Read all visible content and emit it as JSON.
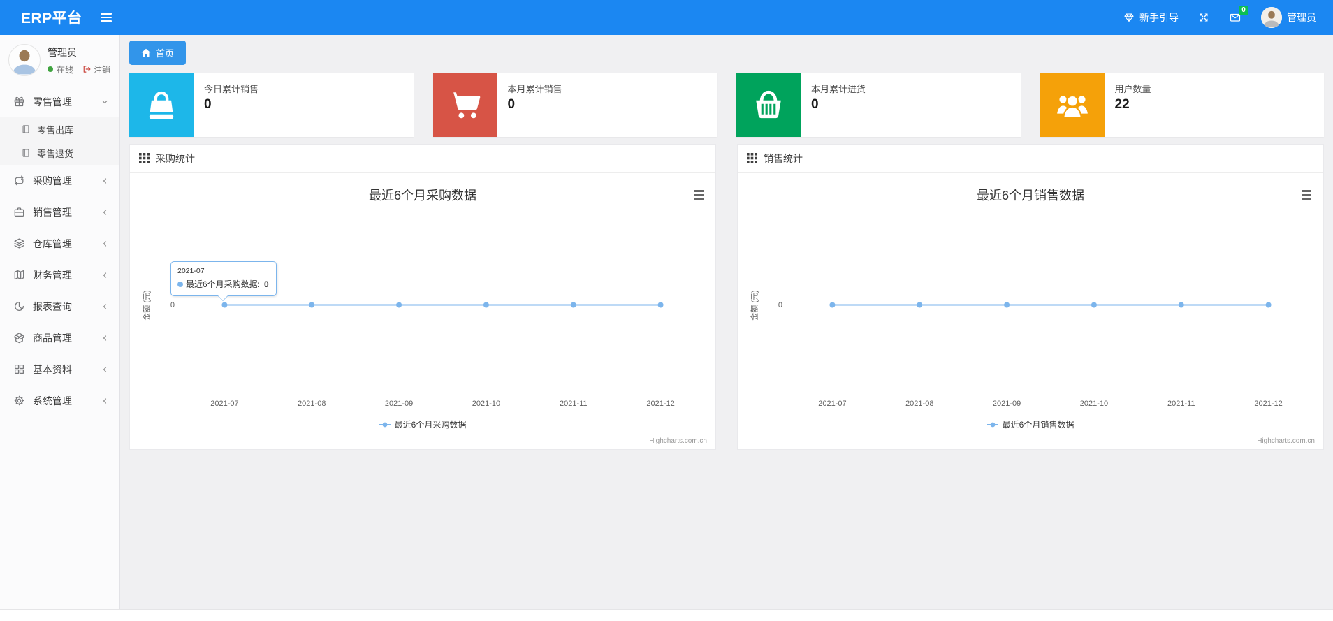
{
  "colors": {
    "navbar_bg": "#1b87f2",
    "tab_bg": "#3295ea",
    "badge_green": "#0cbf53",
    "status_green": "#3fa33f",
    "logout_red": "#c9443c",
    "series_blue": "#7cb5ec"
  },
  "navbar": {
    "brand": "ERP平台",
    "guide_label": "新手引导",
    "mail_badge": "0",
    "user_name": "管理员"
  },
  "sidebar": {
    "user": {
      "name": "管理员",
      "status": "在线",
      "logout": "注销"
    },
    "menu": [
      {
        "label": "零售管理",
        "icon": "gift-icon",
        "state": "expanded",
        "children": [
          "零售出库",
          "零售退货"
        ]
      },
      {
        "label": "采购管理",
        "icon": "repeat-icon",
        "state": "collapsed"
      },
      {
        "label": "销售管理",
        "icon": "briefcase-icon",
        "state": "collapsed"
      },
      {
        "label": "仓库管理",
        "icon": "layers-icon",
        "state": "collapsed"
      },
      {
        "label": "财务管理",
        "icon": "map-book-icon",
        "state": "collapsed"
      },
      {
        "label": "报表查询",
        "icon": "pie-chart-icon",
        "state": "collapsed"
      },
      {
        "label": "商品管理",
        "icon": "box-icon",
        "state": "collapsed"
      },
      {
        "label": "基本资料",
        "icon": "grid-4-icon",
        "state": "collapsed"
      },
      {
        "label": "系统管理",
        "icon": "gear-icon",
        "state": "collapsed"
      }
    ]
  },
  "tabs": {
    "home": "首页"
  },
  "stat_cards": [
    {
      "title": "今日累计销售",
      "value": "0",
      "color": "#1db7e9",
      "icon": "shopping-bag-icon"
    },
    {
      "title": "本月累计销售",
      "value": "0",
      "color": "#d75446",
      "icon": "shopping-cart-icon"
    },
    {
      "title": "本月累计进货",
      "value": "0",
      "color": "#00a35c",
      "icon": "shopping-basket-icon"
    },
    {
      "title": "用户数量",
      "value": "22",
      "color": "#f5a109",
      "icon": "users-icon"
    }
  ],
  "panels": [
    {
      "title": "采购统计"
    },
    {
      "title": "销售统计"
    }
  ],
  "chart_data": [
    {
      "type": "line",
      "title": "最近6个月采购数据",
      "categories": [
        "2021-07",
        "2021-08",
        "2021-09",
        "2021-10",
        "2021-11",
        "2021-12"
      ],
      "series": [
        {
          "name": "最近6个月采购数据",
          "values": [
            0,
            0,
            0,
            0,
            0,
            0
          ],
          "color": "#7cb5ec"
        }
      ],
      "ylabel": "金额 (元)",
      "ylim": [
        -1,
        1
      ],
      "yticks": [
        {
          "value": 0,
          "label": "0"
        }
      ],
      "legend_position": "bottom",
      "credit": "Highcharts.com.cn",
      "tooltip": {
        "header": "2021-07",
        "series_label": "最近6个月采购数据:",
        "value": "0"
      }
    },
    {
      "type": "line",
      "title": "最近6个月销售数据",
      "categories": [
        "2021-07",
        "2021-08",
        "2021-09",
        "2021-10",
        "2021-11",
        "2021-12"
      ],
      "series": [
        {
          "name": "最近6个月销售数据",
          "values": [
            0,
            0,
            0,
            0,
            0,
            0
          ],
          "color": "#7cb5ec"
        }
      ],
      "ylabel": "金额 (元)",
      "ylim": [
        -1,
        1
      ],
      "yticks": [
        {
          "value": 0,
          "label": "0"
        }
      ],
      "legend_position": "bottom",
      "credit": "Highcharts.com.cn"
    }
  ]
}
